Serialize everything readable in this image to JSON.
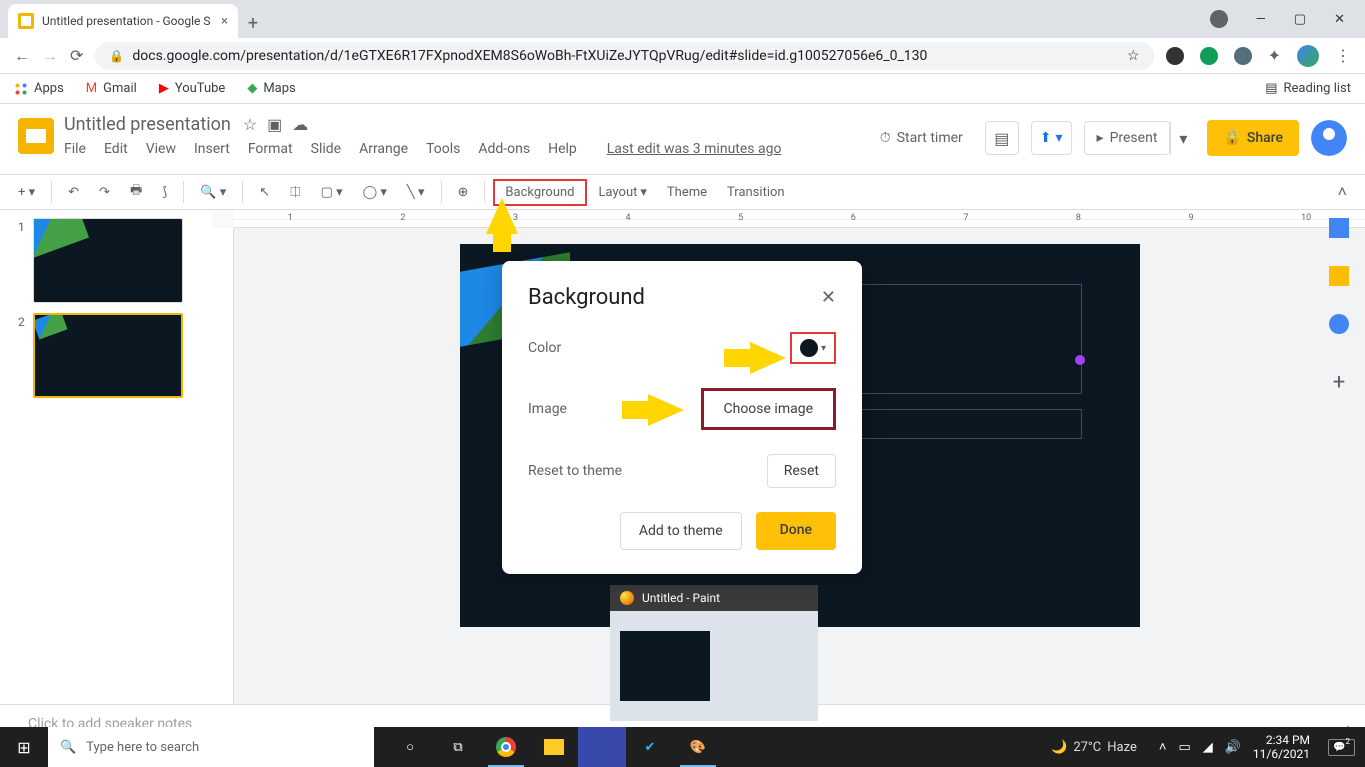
{
  "browser": {
    "tab_title": "Untitled presentation - Google S",
    "url": "docs.google.com/presentation/d/1eGTXE6R17FXpnodXEM8S6oWoBh-FtXUiZeJYTQpVRug/edit#slide=id.g100527056e6_0_130",
    "reading_list": "Reading list",
    "bookmarks": {
      "apps": "Apps",
      "gmail": "Gmail",
      "youtube": "YouTube",
      "maps": "Maps"
    }
  },
  "gs": {
    "title": "Untitled presentation",
    "menus": [
      "File",
      "Edit",
      "View",
      "Insert",
      "Format",
      "Slide",
      "Arrange",
      "Tools",
      "Add-ons",
      "Help"
    ],
    "edit_info": "Last edit was 3 minutes ago",
    "start_timer": "Start timer",
    "present": "Present",
    "share": "Share"
  },
  "toolbar": {
    "background": "Background",
    "layout": "Layout",
    "theme": "Theme",
    "transition": "Transition"
  },
  "thumbs": {
    "n1": "1",
    "n2": "2"
  },
  "dialog": {
    "title": "Background",
    "color_label": "Color",
    "image_label": "Image",
    "choose_image": "Choose image",
    "reset_label": "Reset to theme",
    "reset_btn": "Reset",
    "add_theme": "Add to theme",
    "done": "Done"
  },
  "notes": "Click to add speaker notes",
  "paint": {
    "title": "Untitled - Paint"
  },
  "taskbar": {
    "search_placeholder": "Type here to search",
    "weather_temp": "27°C",
    "weather_cond": "Haze",
    "time": "2:34 PM",
    "date": "11/6/2021",
    "notif_count": "2"
  },
  "ruler": [
    "1",
    "2",
    "3",
    "4",
    "5",
    "6",
    "7",
    "8",
    "9",
    "10"
  ]
}
